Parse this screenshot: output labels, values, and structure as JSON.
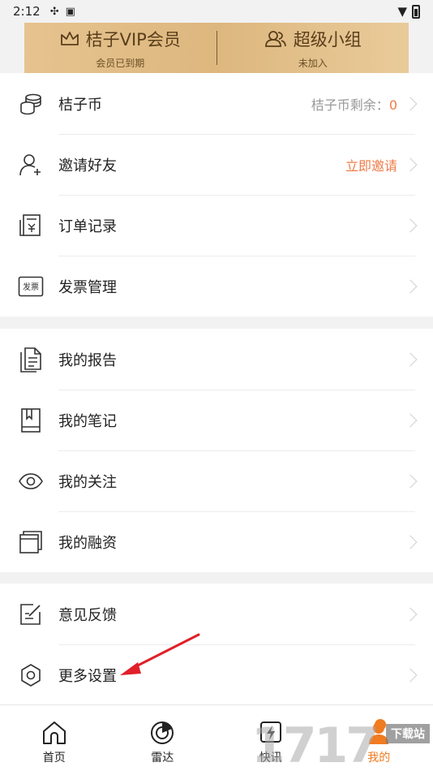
{
  "status_bar": {
    "time": "2:12"
  },
  "vip": {
    "left_title": "桔子VIP会员",
    "left_sub": "会员已到期",
    "right_title": "超级小组",
    "right_sub": "未加入"
  },
  "section1": [
    {
      "label": "桔子币",
      "extra_prefix": "桔子币剩余：",
      "extra_num": "0",
      "icon": "coins-icon"
    },
    {
      "label": "邀请好友",
      "extra": "立即邀请",
      "icon": "add-user-icon"
    },
    {
      "label": "订单记录",
      "icon": "receipt-icon"
    },
    {
      "label": "发票管理",
      "icon": "invoice-icon",
      "icon_text": "发票"
    }
  ],
  "section2": [
    {
      "label": "我的报告",
      "icon": "report-icon"
    },
    {
      "label": "我的笔记",
      "icon": "notebook-icon"
    },
    {
      "label": "我的关注",
      "icon": "eye-icon"
    },
    {
      "label": "我的融资",
      "icon": "financing-icon"
    }
  ],
  "section3": [
    {
      "label": "意见反馈",
      "icon": "feedback-icon"
    },
    {
      "label": "更多设置",
      "icon": "settings-gear-icon"
    }
  ],
  "tabs": [
    {
      "label": "首页",
      "icon": "home-icon"
    },
    {
      "label": "雷达",
      "icon": "radar-icon"
    },
    {
      "label": "快讯",
      "icon": "flash-news-icon"
    },
    {
      "label": "我的",
      "icon": "profile-icon"
    }
  ],
  "watermark": {
    "big": "1717",
    "small": "下载站"
  },
  "colors": {
    "accent": "#f07b47",
    "vip_gold": "#ddb77e",
    "arrow": "#e0202a"
  }
}
